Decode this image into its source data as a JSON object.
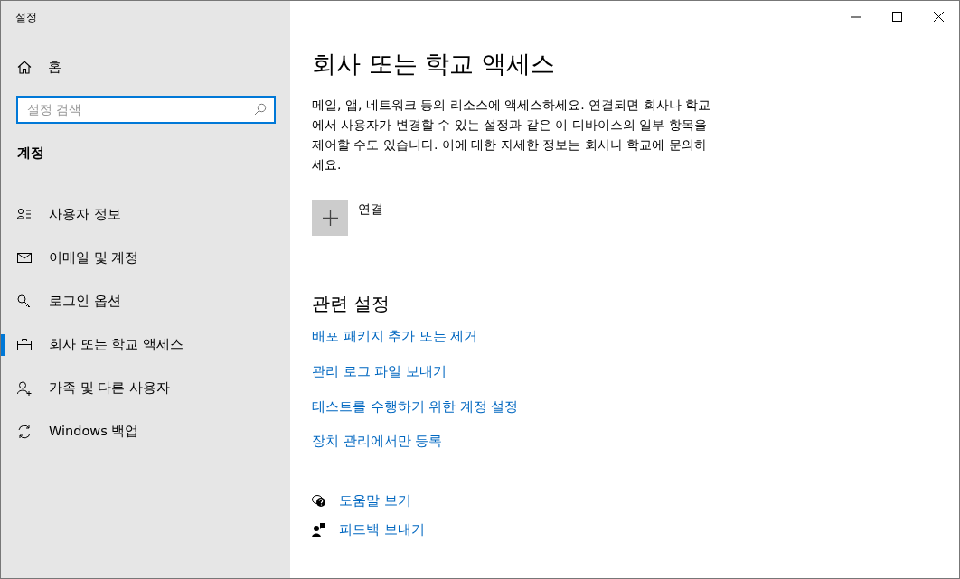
{
  "window": {
    "title": "설정"
  },
  "sidebar": {
    "home": "홈",
    "search": {
      "placeholder": "설정 검색"
    },
    "section": "계정",
    "items": [
      {
        "label": "사용자 정보",
        "selected": false
      },
      {
        "label": "이메일 및 계정",
        "selected": false
      },
      {
        "label": "로그인 옵션",
        "selected": false
      },
      {
        "label": "회사 또는 학교 액세스",
        "selected": true
      },
      {
        "label": "가족 및 다른 사용자",
        "selected": false
      },
      {
        "label": "Windows 백업",
        "selected": false
      }
    ]
  },
  "main": {
    "title": "회사 또는 학교 액세스",
    "description": "메일, 앱, 네트워크 등의 리소스에 액세스하세요. 연결되면 회사나 학교에서 사용자가 변경할 수 있는 설정과 같은 이 디바이스의 일부 항목을 제어할 수도 있습니다. 이에 대한 자세한 정보는 회사나 학교에 문의하세요.",
    "connect": "연결",
    "related_heading": "관련 설정",
    "related_links": [
      "배포 패키지 추가 또는 제거",
      "관리 로그 파일 보내기",
      "테스트를 수행하기 위한 계정 설정",
      "장치 관리에서만 등록"
    ],
    "help_links": [
      "도움말 보기",
      "피드백 보내기"
    ]
  }
}
